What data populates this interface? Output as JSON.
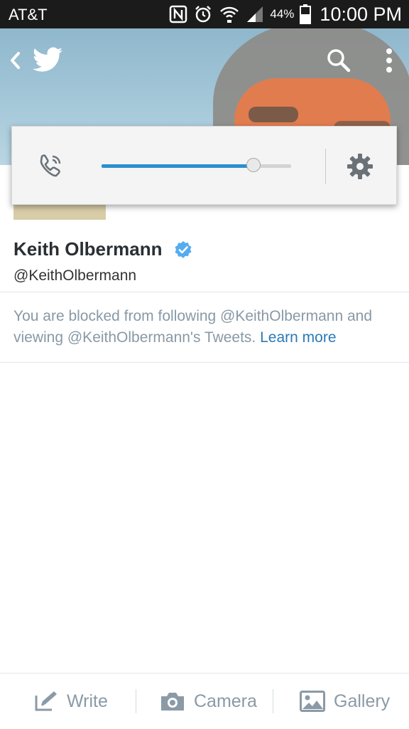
{
  "status_bar": {
    "carrier": "AT&T",
    "battery_percent": "44%",
    "time": "10:00 PM",
    "icons": [
      "nfc-icon",
      "alarm-icon",
      "wifi-icon",
      "signal-icon",
      "battery-icon"
    ]
  },
  "nav": {
    "icons": [
      "back-icon",
      "twitter-bird-icon",
      "search-icon",
      "more-vertical-icon"
    ]
  },
  "volume_popup": {
    "icon": "phone-volume-icon",
    "level": 0.8,
    "settings_icon": "gear-icon"
  },
  "profile": {
    "name": "Keith Olbermann",
    "handle": "@KeithOlbermann",
    "verified": true,
    "blocked_message": "You are blocked from following @KeithOlbermann and viewing @KeithOlbermann's Tweets.",
    "learn_more": "Learn more"
  },
  "bottom_bar": {
    "write": "Write",
    "camera": "Camera",
    "gallery": "Gallery"
  },
  "colors": {
    "accent_blue": "#2a8fd0",
    "link_blue": "#2a7ab8",
    "verified_blue": "#55acee",
    "muted_text": "#8899a6"
  }
}
